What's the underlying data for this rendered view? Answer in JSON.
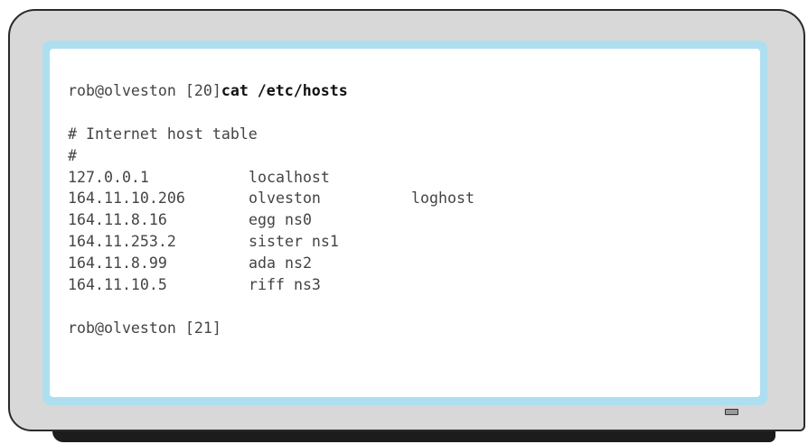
{
  "terminal": {
    "prompt_1": "rob@olveston [20]",
    "command_1": "cat /etc/hosts",
    "comment_1": "# Internet host table",
    "comment_2": "#",
    "hosts": [
      {
        "ip": "127.0.0.1",
        "name": "localhost",
        "alias": ""
      },
      {
        "ip": "164.11.10.206",
        "name": "olveston",
        "alias": "loghost"
      },
      {
        "ip": "164.11.8.16",
        "name": "egg ns0",
        "alias": ""
      },
      {
        "ip": "164.11.253.2",
        "name": "sister ns1",
        "alias": ""
      },
      {
        "ip": "164.11.8.99",
        "name": "ada ns2",
        "alias": ""
      },
      {
        "ip": "164.11.10.5",
        "name": "riff ns3",
        "alias": ""
      }
    ],
    "prompt_2": "rob@olveston [21]"
  }
}
